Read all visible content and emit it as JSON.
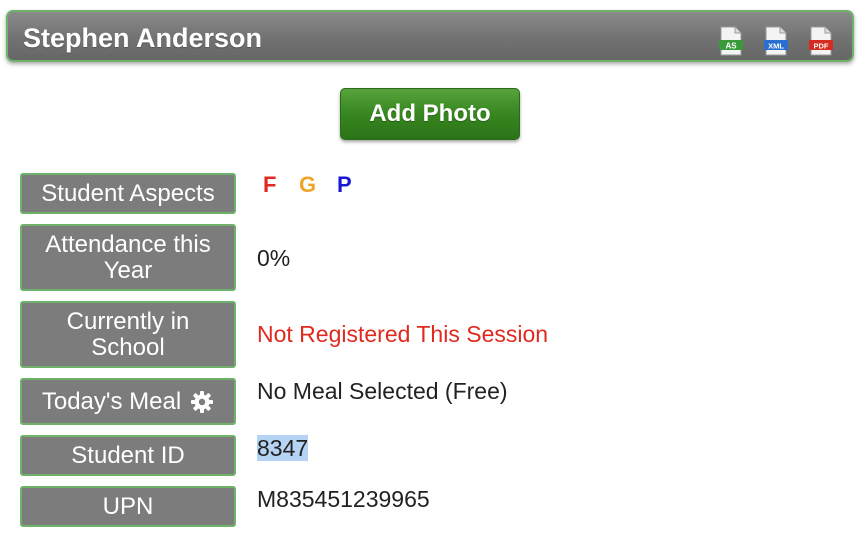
{
  "header": {
    "title": "Stephen Anderson"
  },
  "exports": [
    {
      "label": "AS",
      "color": "#3a9a3a"
    },
    {
      "label": "XML",
      "color": "#2a6fd0"
    },
    {
      "label": "PDF",
      "color": "#d62b20"
    }
  ],
  "add_photo_label": "Add Photo",
  "fields": {
    "aspects": {
      "label": "Student Aspects",
      "items": [
        {
          "letter": "F",
          "color": "#e02a1f"
        },
        {
          "letter": "G",
          "color": "#f0a52a"
        },
        {
          "letter": "P",
          "color": "#1a17d6"
        }
      ]
    },
    "attendance": {
      "label": "Attendance this Year",
      "value": "0%"
    },
    "in_school": {
      "label": "Currently in School",
      "value": "Not Registered This Session"
    },
    "meal": {
      "label": "Today's Meal",
      "value": "No Meal Selected (Free)"
    },
    "student_id": {
      "label": "Student ID",
      "value": "8347"
    },
    "upn": {
      "label": "UPN",
      "value": "M835451239965"
    }
  }
}
